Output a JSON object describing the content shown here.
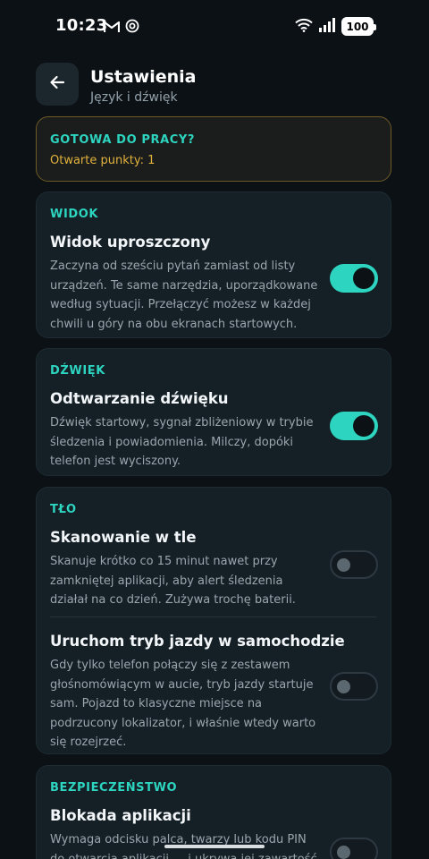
{
  "status_bar": {
    "time": "10:23",
    "battery": "100"
  },
  "header": {
    "title": "Ustawienia",
    "subtitle": "Język i dźwięk"
  },
  "ready": {
    "title": "GOTOWA DO PRACY?",
    "points": "Otwarte punkty: 1"
  },
  "sections": {
    "view": {
      "label": "WIDOK",
      "title": "Widok uproszczony",
      "desc": "Zaczyna od sześciu pytań zamiast od listy urządzeń. Te same narzędzia, uporządkowane według sytuacji. Przełączyć możesz w każdej chwili u góry na obu ekranach startowych.",
      "enabled": true
    },
    "sound": {
      "label": "DŹWIĘK",
      "title": "Odtwarzanie dźwięku",
      "desc": "Dźwięk startowy, sygnał zbliżeniowy w trybie śledzenia i powiadomienia. Milczy, dopóki telefon jest wyciszony.",
      "enabled": true
    },
    "background": {
      "label": "TŁO",
      "items": [
        {
          "title": "Skanowanie w tle",
          "desc": "Skanuje krótko co 15 minut nawet przy zamkniętej aplikacji, aby alert śledzenia działał na co dzień. Zużywa trochę baterii.",
          "enabled": false
        },
        {
          "title": "Uruchom tryb jazdy w samochodzie",
          "desc": "Gdy tylko telefon połączy się z zestawem głośnomówiącym w aucie, tryb jazdy startuje sam. Pojazd to klasyczne miejsce na podrzucony lokalizator, i właśnie wtedy warto się rozejrzeć.",
          "enabled": false
        }
      ]
    },
    "security": {
      "label": "BEZPIECZEŃSTWO",
      "title": "Blokada aplikacji",
      "desc": "Wymaga odcisku palca, twarzy lub kodu PIN do otwarcia aplikacji — i ukrywa jej zawartość w",
      "enabled": false
    }
  },
  "colors": {
    "accent": "#2dd4bf",
    "warning": "#e2b13c",
    "background": "#0b1115",
    "card": "#151f26"
  }
}
